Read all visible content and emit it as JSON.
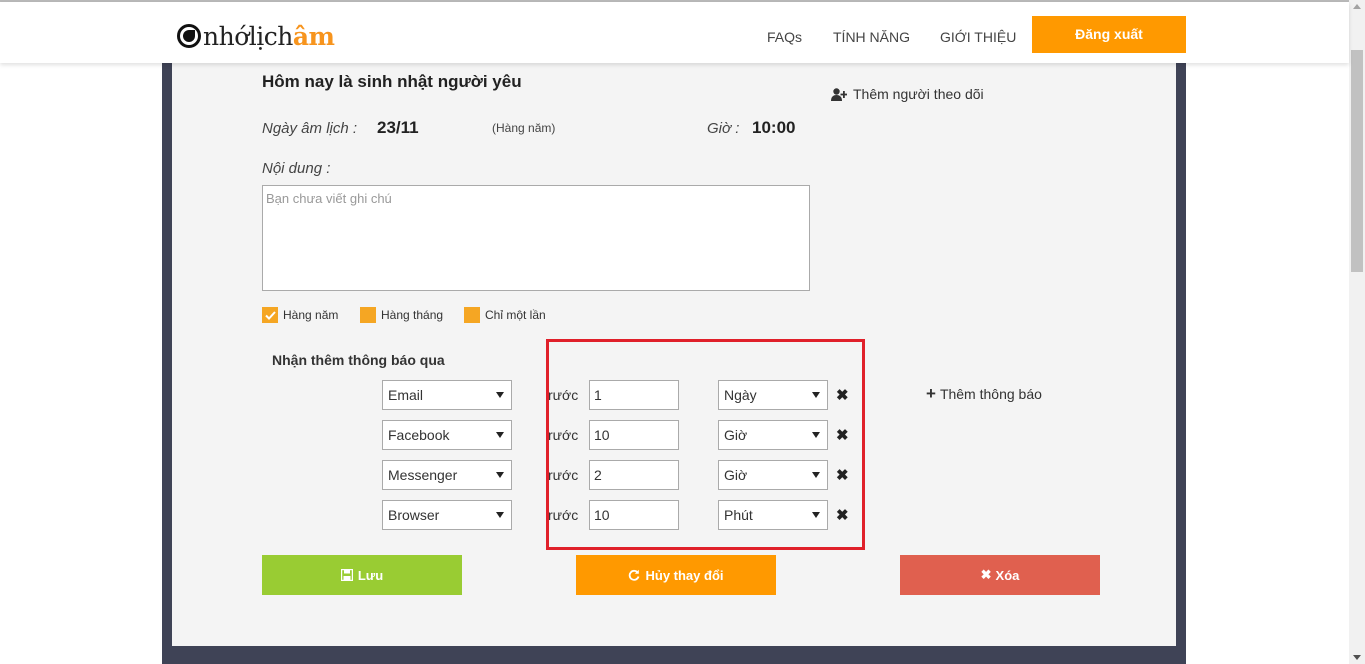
{
  "header": {
    "logo_part1": "nhớlịch",
    "logo_part2": "âm",
    "nav": [
      "FAQs",
      "TÍNH NĂNG",
      "GIỚI THIỆU"
    ],
    "logout_label": "Đăng xuất"
  },
  "event": {
    "title": "Hôm nay là sinh nhật người yêu",
    "add_follower": "Thêm người theo dõi",
    "lunar_date_label": "Ngày âm lịch :",
    "lunar_date_value": "23/11",
    "repeat_note": "(Hàng năm)",
    "time_label": "Giờ :",
    "time_value": "10:00",
    "content_label": "Nội dung :",
    "content_placeholder": "Bạn chưa viết ghi chú",
    "content_value": ""
  },
  "repeat_options": [
    {
      "label": "Hàng năm",
      "checked": true
    },
    {
      "label": "Hàng tháng",
      "checked": false
    },
    {
      "label": "Chỉ một lần",
      "checked": false
    }
  ],
  "notifications": {
    "title": "Nhận thêm thông báo qua",
    "before_label": "rước",
    "add_label": "Thêm thông báo",
    "rows": [
      {
        "channel": "Email",
        "amount": "1",
        "unit": "Ngày"
      },
      {
        "channel": "Facebook",
        "amount": "10",
        "unit": "Giờ"
      },
      {
        "channel": "Messenger",
        "amount": "2",
        "unit": "Giờ"
      },
      {
        "channel": "Browser",
        "amount": "10",
        "unit": "Phút"
      }
    ]
  },
  "actions": {
    "save": "Lưu",
    "cancel": "Hủy thay đổi",
    "delete": "Xóa"
  },
  "colors": {
    "accent": "#ff9900",
    "frame": "#3f4356",
    "save": "#99cc33",
    "delete": "#e0604f",
    "highlight": "#e0202a"
  }
}
